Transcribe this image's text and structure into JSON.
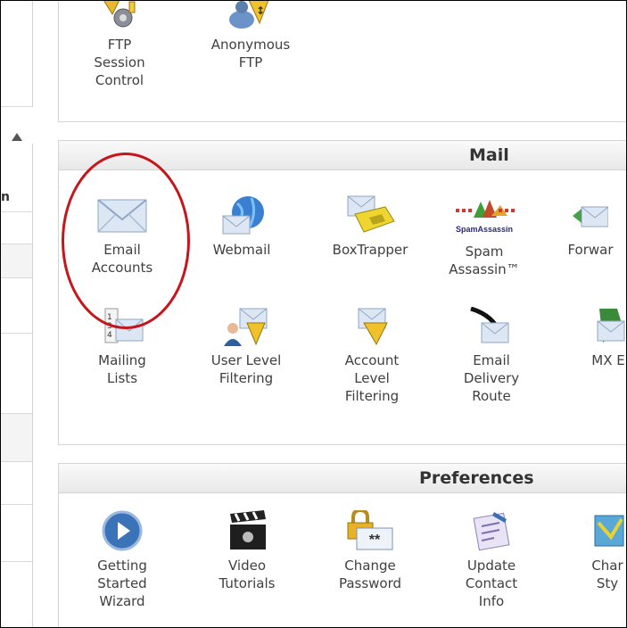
{
  "ftp_panel": {
    "items": [
      {
        "label": "FTP\nSession\nControl",
        "icon": "ftp-session-gear-icon"
      },
      {
        "label": "Anonymous\nFTP",
        "icon": "anonymous-ftp-icon"
      }
    ]
  },
  "sidebar": {
    "fragment": "n"
  },
  "mail_panel": {
    "title": "Mail",
    "items": [
      {
        "label": "Email\nAccounts",
        "icon": "envelope-icon"
      },
      {
        "label": "Webmail",
        "icon": "globe-envelope-icon"
      },
      {
        "label": "BoxTrapper",
        "icon": "boxtrapper-icon"
      },
      {
        "label": "Spam\nAssassin™",
        "icon": "spamassassin-icon",
        "logo_text": "SpamAssassin"
      },
      {
        "label": "Forwar",
        "icon": "forwarder-icon"
      },
      {
        "label": "Mailing\nLists",
        "icon": "mailing-lists-icon"
      },
      {
        "label": "User Level\nFiltering",
        "icon": "user-filter-icon"
      },
      {
        "label": "Account\nLevel\nFiltering",
        "icon": "account-filter-icon"
      },
      {
        "label": "Email\nDelivery\nRoute",
        "icon": "delivery-route-icon"
      },
      {
        "label": "MX E",
        "icon": "mx-entry-icon"
      }
    ]
  },
  "preferences_panel": {
    "title": "Preferences",
    "items": [
      {
        "label": "Getting\nStarted\nWizard",
        "icon": "play-button-icon"
      },
      {
        "label": "Video\nTutorials",
        "icon": "clapperboard-icon"
      },
      {
        "label": "Change\nPassword",
        "icon": "lock-password-icon"
      },
      {
        "label": "Update\nContact\nInfo",
        "icon": "contact-info-icon"
      },
      {
        "label": "Char\nSty",
        "icon": "change-style-icon"
      }
    ]
  },
  "annotation": {
    "color": "#c4161c",
    "target": "Email Accounts"
  },
  "colors": {
    "panel_border": "#d4d4d4",
    "header_bg": "#ececec",
    "envelope": "#9bb3d3"
  }
}
